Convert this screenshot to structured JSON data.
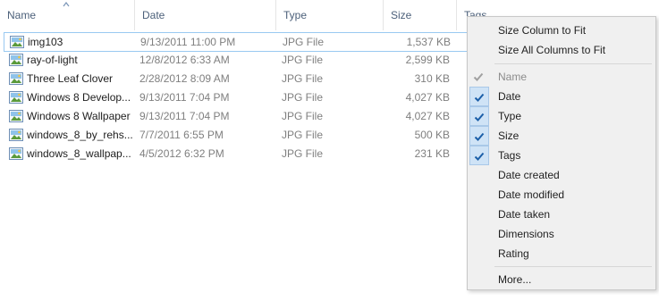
{
  "columns": {
    "name": "Name",
    "date": "Date",
    "type": "Type",
    "size": "Size",
    "tags": "Tags"
  },
  "files": [
    {
      "name": "img103",
      "date": "9/13/2011 11:00 PM",
      "type": "JPG File",
      "size": "1,537 KB"
    },
    {
      "name": "ray-of-light",
      "date": "12/8/2012 6:33 AM",
      "type": "JPG File",
      "size": "2,599 KB"
    },
    {
      "name": "Three Leaf Clover",
      "date": "2/28/2012 8:09 AM",
      "type": "JPG File",
      "size": "310 KB"
    },
    {
      "name": "Windows 8 Develop...",
      "date": "9/13/2011 7:04 PM",
      "type": "JPG File",
      "size": "4,027 KB"
    },
    {
      "name": "Windows 8 Wallpaper",
      "date": "9/13/2011 7:04 PM",
      "type": "JPG File",
      "size": "4,027 KB"
    },
    {
      "name": "windows_8_by_rehs...",
      "date": "7/7/2011 6:55 PM",
      "type": "JPG File",
      "size": "500 KB"
    },
    {
      "name": "windows_8_wallpap...",
      "date": "4/5/2012 6:32 PM",
      "type": "JPG File",
      "size": "231 KB"
    }
  ],
  "menu": {
    "size_column": "Size Column to Fit",
    "size_all": "Size All Columns to Fit",
    "items": [
      {
        "label": "Name",
        "checked": true,
        "disabled": true
      },
      {
        "label": "Date",
        "checked": true,
        "disabled": false
      },
      {
        "label": "Type",
        "checked": true,
        "disabled": false
      },
      {
        "label": "Size",
        "checked": true,
        "disabled": false
      },
      {
        "label": "Tags",
        "checked": true,
        "disabled": false
      },
      {
        "label": "Date created",
        "checked": false,
        "disabled": false
      },
      {
        "label": "Date modified",
        "checked": false,
        "disabled": false
      },
      {
        "label": "Date taken",
        "checked": false,
        "disabled": false
      },
      {
        "label": "Dimensions",
        "checked": false,
        "disabled": false
      },
      {
        "label": "Rating",
        "checked": false,
        "disabled": false
      }
    ],
    "more": "More..."
  },
  "colors": {
    "header_text": "#4c607a",
    "selection_border": "#99c9f1",
    "check_bg": "#cfe3f6",
    "check_mark": "#1c5fa8"
  }
}
